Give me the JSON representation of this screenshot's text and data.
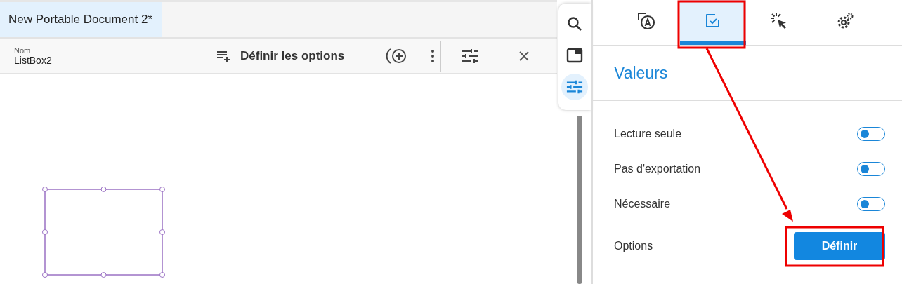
{
  "document_tabs": [
    {
      "label": "New Portable Document 2*",
      "selected": true
    }
  ],
  "toolbar": {
    "name_label": "Nom",
    "name_value": "ListBox2",
    "options_button": "Définir les options"
  },
  "side_tools": [
    {
      "selected": false
    },
    {
      "selected": false
    },
    {
      "selected": true
    }
  ],
  "panel_tabs": [
    {
      "selected": false
    },
    {
      "selected": true
    },
    {
      "selected": false
    },
    {
      "selected": false
    }
  ],
  "panel": {
    "heading": "Valeurs",
    "toggles": [
      {
        "label": "Lecture seule",
        "on": false
      },
      {
        "label": "Pas d'exportation",
        "on": false
      },
      {
        "label": "Nécessaire",
        "on": false
      }
    ],
    "options_label": "Options",
    "options_button": "Définir"
  }
}
